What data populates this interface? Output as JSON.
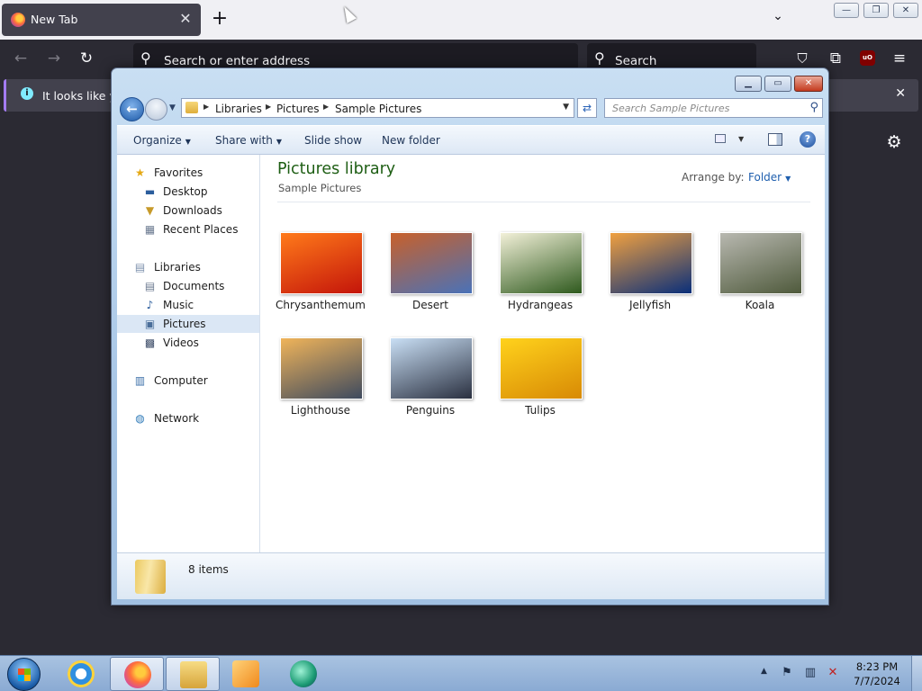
{
  "firefox": {
    "tab_title": "New Tab",
    "tab_close": "✕",
    "new_tab": "+",
    "url_placeholder": "Search or enter address",
    "search_placeholder": "Search",
    "notification_text": "It looks like you",
    "notification_close": "✕",
    "ublock_label": "uO"
  },
  "explorer": {
    "breadcrumb": [
      "Libraries",
      "Pictures",
      "Sample Pictures"
    ],
    "search_placeholder": "Search Sample Pictures",
    "toolbar": {
      "organize": "Organize",
      "share_with": "Share with",
      "slide_show": "Slide show",
      "new_folder": "New folder"
    },
    "nav": {
      "favorites": "Favorites",
      "desktop": "Desktop",
      "downloads": "Downloads",
      "recent_places": "Recent Places",
      "libraries": "Libraries",
      "documents": "Documents",
      "music": "Music",
      "pictures": "Pictures",
      "videos": "Videos",
      "computer": "Computer",
      "network": "Network"
    },
    "library_title": "Pictures library",
    "library_subtitle": "Sample Pictures",
    "arrange_label": "Arrange by:",
    "arrange_value": "Folder",
    "pictures": [
      {
        "name": "Chrysanthemum",
        "colors": [
          "#ff7a1a",
          "#c4150a"
        ]
      },
      {
        "name": "Desert",
        "colors": [
          "#c8602a",
          "#4a72b8"
        ]
      },
      {
        "name": "Hydrangeas",
        "colors": [
          "#f2f0d8",
          "#2f5a1e"
        ]
      },
      {
        "name": "Jellyfish",
        "colors": [
          "#f0a040",
          "#0a2f7a"
        ]
      },
      {
        "name": "Koala",
        "colors": [
          "#b8b8b0",
          "#4f5a3c"
        ]
      },
      {
        "name": "Lighthouse",
        "colors": [
          "#f0b45a",
          "#3e4a5e"
        ]
      },
      {
        "name": "Penguins",
        "colors": [
          "#c9dff5",
          "#2a3040"
        ]
      },
      {
        "name": "Tulips",
        "colors": [
          "#ffd21c",
          "#d88a05"
        ]
      }
    ],
    "status": "8 items"
  },
  "taskbar": {
    "time": "8:23 PM",
    "date": "7/7/2024"
  },
  "colors": {
    "firefox_dark": "#2b2a33",
    "explorer_frame": "#a8c6e6",
    "library_title": "#1e5e14",
    "accent_blue": "#1f5fae"
  }
}
